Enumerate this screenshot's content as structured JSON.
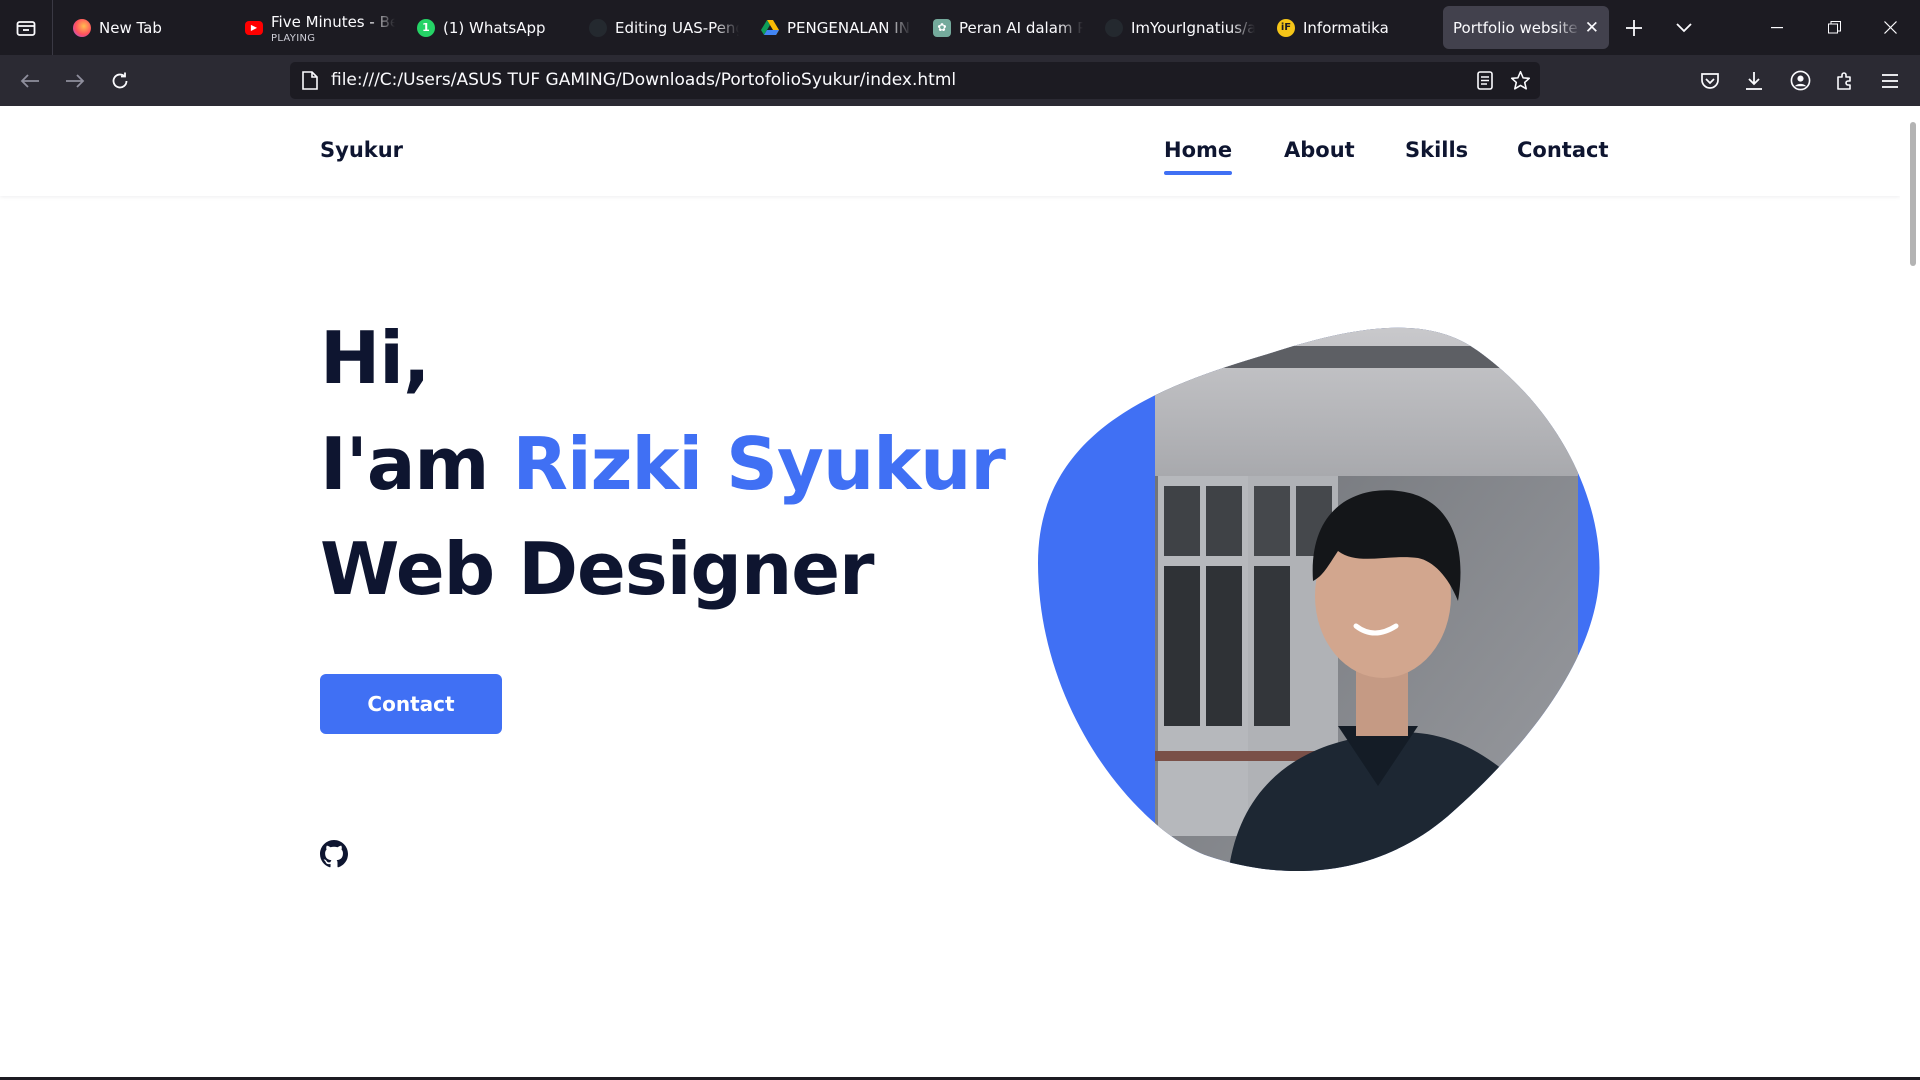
{
  "browser": {
    "tabs": [
      {
        "title": "New Tab",
        "icon": "firefox-icon"
      },
      {
        "title": "Five Minutes - Bea",
        "sub": "PLAYING",
        "icon": "youtube-icon"
      },
      {
        "title": "(1) WhatsApp",
        "icon": "whatsapp-icon"
      },
      {
        "title": "Editing UAS-Peng",
        "icon": "github-icon"
      },
      {
        "title": "PENGENALAN INF",
        "icon": "google-drive-icon"
      },
      {
        "title": "Peran AI dalam Pe",
        "icon": "chatgpt-icon"
      },
      {
        "title": "ImYourIgnatius/as",
        "icon": "github-icon"
      },
      {
        "title": "Informatika",
        "icon": "informatika-icon"
      },
      {
        "title": "Portfolio website R",
        "icon": "none",
        "active": true
      }
    ],
    "url": "file:///C:/Users/ASUS TUF GAMING/Downloads/PortofolioSyukur/index.html"
  },
  "site": {
    "logo": "Syukur",
    "nav": [
      "Home",
      "About",
      "Skills",
      "Contact"
    ],
    "active_nav": "Home",
    "hero": {
      "line1": "Hi,",
      "line2_prefix": "I'am ",
      "line2_name": "Rizki Syukur",
      "line3": "Web Designer"
    },
    "cta_label": "Contact",
    "social_icon": "github-icon",
    "photo_alt": "Portrait photo of Rizki Syukur"
  },
  "colors": {
    "accent": "#4070f4",
    "heading": "#0e1530",
    "chrome_dark": "#1c1b22",
    "chrome_toolbar": "#2b2a33",
    "active_tab": "#42414d"
  }
}
